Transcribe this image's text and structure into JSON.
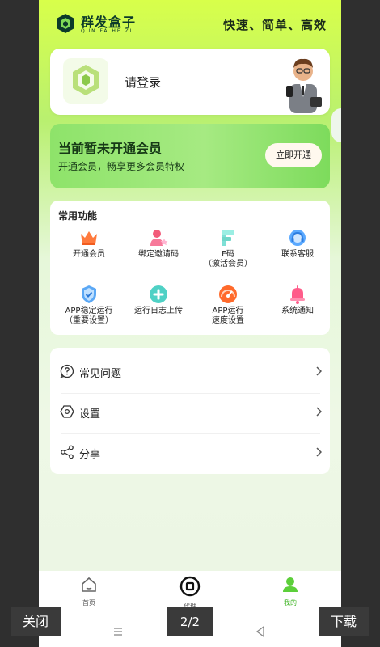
{
  "header": {
    "brand": "群发盒子",
    "brand_sub": "QUN FA HE ZI",
    "slogan": "快速、简单、高效"
  },
  "login": {
    "label": "请登录"
  },
  "vip": {
    "title": "当前暂未开通会员",
    "subtitle": "开通会员，畅享更多会员特权",
    "button": "立即开通"
  },
  "functions": {
    "title": "常用功能",
    "items": [
      {
        "label": "开通会员",
        "icon": "crown-icon"
      },
      {
        "label": "绑定邀请码",
        "icon": "user-star-icon"
      },
      {
        "label": "F码\n（激活会员）",
        "icon": "f-code-icon"
      },
      {
        "label": "联系客服",
        "icon": "headset-icon"
      },
      {
        "label": "APP稳定运行\n（重要设置）",
        "icon": "shield-check-icon"
      },
      {
        "label": "运行日志上传",
        "icon": "plus-circle-icon"
      },
      {
        "label": "APP运行\n速度设置",
        "icon": "speedometer-icon"
      },
      {
        "label": "系统通知",
        "icon": "bell-icon"
      }
    ]
  },
  "menu": {
    "items": [
      {
        "label": "常见问题",
        "icon": "question-icon"
      },
      {
        "label": "设置",
        "icon": "hexagon-settings-icon"
      },
      {
        "label": "分享",
        "icon": "share-icon"
      }
    ]
  },
  "tabs": [
    {
      "label": "首页",
      "icon": "home-icon"
    },
    {
      "label": "代理",
      "icon": "proxy-icon"
    },
    {
      "label": "我的",
      "icon": "user-icon",
      "active": true
    }
  ],
  "viewer": {
    "close": "关闭",
    "page": "2/2",
    "download": "下载"
  },
  "colors": {
    "accent": "#5ccf3a",
    "brand_dark": "#0b3a2a"
  }
}
